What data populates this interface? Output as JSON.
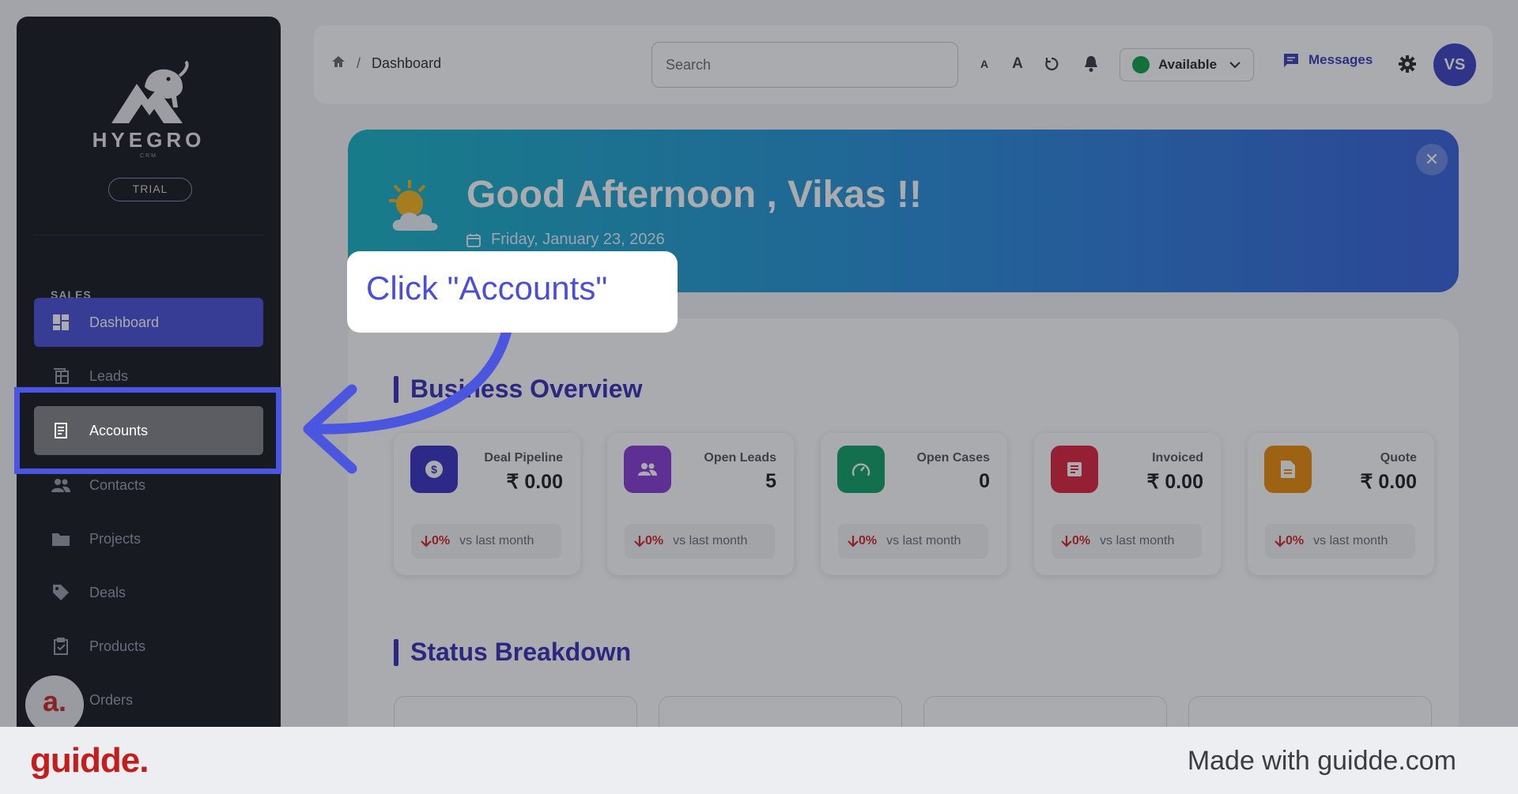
{
  "sidebar": {
    "brand_name": "HYEGRO",
    "brand_sub": "CRM",
    "plan_badge": "TRIAL",
    "section_label": "SALES",
    "items": [
      {
        "label": "Dashboard",
        "icon": "dashboard-icon"
      },
      {
        "label": "Leads",
        "icon": "leads-icon"
      },
      {
        "label": "Accounts",
        "icon": "accounts-icon"
      },
      {
        "label": "Contacts",
        "icon": "contacts-icon"
      },
      {
        "label": "Projects",
        "icon": "folder-icon"
      },
      {
        "label": "Deals",
        "icon": "tag-icon"
      },
      {
        "label": "Products",
        "icon": "clipboard-check-icon"
      },
      {
        "label": "Orders",
        "icon": "cart-icon"
      }
    ],
    "help_launcher": "a."
  },
  "header": {
    "breadcrumb": "Dashboard",
    "breadcrumb_sep": "/",
    "search_placeholder": "Search",
    "font_small": "A",
    "font_large": "A",
    "status": "Available",
    "messages": "Messages",
    "avatar_initials": "VS"
  },
  "banner": {
    "greeting": "Good Afternoon , Vikas !!",
    "date": "Friday, January 23, 2026",
    "close": "✕"
  },
  "overview": {
    "title": "Business Overview",
    "cards": [
      {
        "label": "Deal Pipeline",
        "value": "₹ 0.00",
        "change": "0%",
        "vs": "vs last month",
        "color": "#3b35c4",
        "icon": "dollar-icon"
      },
      {
        "label": "Open Leads",
        "value": "5",
        "change": "0%",
        "vs": "vs last month",
        "color": "#8a3fd6",
        "icon": "group-icon"
      },
      {
        "label": "Open Cases",
        "value": "0",
        "change": "0%",
        "vs": "vs last month",
        "color": "#13a36a",
        "icon": "gauge-icon"
      },
      {
        "label": "Invoiced",
        "value": "₹ 0.00",
        "change": "0%",
        "vs": "vs last month",
        "color": "#e0263f",
        "icon": "invoice-icon"
      },
      {
        "label": "Quote",
        "value": "₹ 0.00",
        "change": "0%",
        "vs": "vs last month",
        "color": "#ec8f0c",
        "icon": "document-icon"
      }
    ]
  },
  "status_breakdown": {
    "title": "Status Breakdown"
  },
  "callout": {
    "text": "Click \"Accounts\""
  },
  "footer": {
    "brand": "guidde.",
    "made_with": "Made with guidde.com"
  },
  "colors": {
    "accent": "#4a55e0",
    "sidebar_bg": "#1c1d24",
    "brand_red": "#c41d1d"
  }
}
